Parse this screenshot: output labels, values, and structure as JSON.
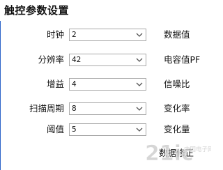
{
  "panel": {
    "title": "触控参数设置"
  },
  "rows": [
    {
      "label": "时钟",
      "value": "2",
      "right_label": "数据值"
    },
    {
      "label": "分辨率",
      "value": "42",
      "right_label": "电容值PF"
    },
    {
      "label": "增益",
      "value": "4",
      "right_label": "信噪比"
    },
    {
      "label": "扫描周期",
      "value": "8",
      "right_label": "变化率"
    },
    {
      "label": "阈值",
      "value": "5",
      "right_label": "变化量"
    }
  ],
  "footer": {
    "label": "数据修正"
  },
  "watermark": {
    "text": "21ic",
    "sub": "中国电子网"
  },
  "colors": {
    "edge": "#2a62c8",
    "border": "#a9a9a9"
  },
  "icons": {
    "dropdown": "chevron-down-icon"
  }
}
